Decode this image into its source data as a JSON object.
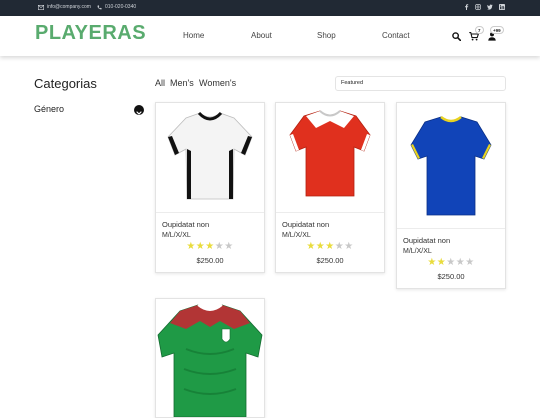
{
  "topbar": {
    "email": "info@company.com",
    "phone": "010-020-0340",
    "socials": [
      "facebook-icon",
      "instagram-icon",
      "twitter-icon",
      "linkedin-icon"
    ]
  },
  "navbar": {
    "logo": "PLAYERAS",
    "links": [
      "Home",
      "About",
      "Shop",
      "Contact"
    ],
    "cart_count": "7",
    "user_count": "+99"
  },
  "sidebar": {
    "title": "Categorias",
    "items": [
      {
        "label": "Género"
      }
    ]
  },
  "filters": {
    "options": [
      "All",
      "Men's",
      "Women's"
    ],
    "sort": {
      "selected": "Featured"
    }
  },
  "products": [
    {
      "name": "Oupidatat non",
      "sizes": "M/L/X/XL",
      "rating": 3,
      "price": "$250.00",
      "jersey": "white"
    },
    {
      "name": "Oupidatat non",
      "sizes": "M/L/X/XL",
      "rating": 3,
      "price": "$250.00",
      "jersey": "red"
    },
    {
      "name": "Oupidatat non",
      "sizes": "M/L/X/XL",
      "rating": 2,
      "price": "$250.00",
      "jersey": "blue"
    },
    {
      "name": "",
      "sizes": "",
      "rating": 0,
      "price": "",
      "jersey": "mexico"
    }
  ],
  "colors": {
    "brand": "#59ab6e",
    "topbar": "#212934",
    "star_on": "#e9dc3c",
    "star_off": "#c8c8c8"
  }
}
